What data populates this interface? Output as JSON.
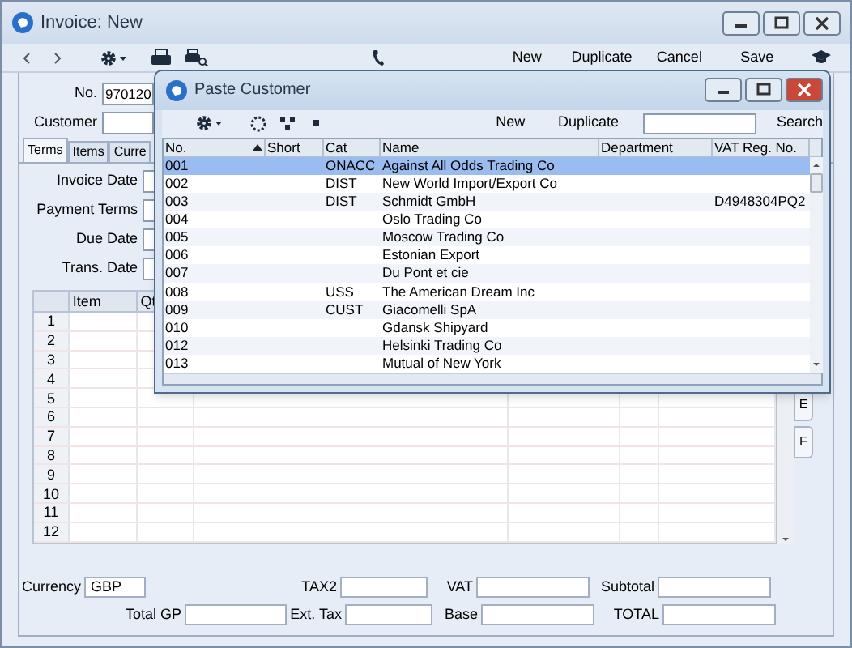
{
  "window": {
    "title": "Invoice: New"
  },
  "toolbar": {
    "buttons": [
      "New",
      "Duplicate",
      "Cancel",
      "Save"
    ]
  },
  "header_fields": [
    {
      "label": "No.",
      "value": "970120"
    },
    {
      "label": "Customer"
    }
  ],
  "tabs": [
    {
      "label": "Terms",
      "selected": true
    },
    {
      "label": "Items",
      "selected": false
    },
    {
      "label": "Curre",
      "selected": false
    }
  ],
  "terms_fields": [
    "Invoice Date",
    "Payment Terms",
    "Due Date",
    "Trans. Date"
  ],
  "grid": {
    "columns": [
      "Item",
      "Qt"
    ],
    "rows": [
      "1",
      "2",
      "3",
      "4",
      "5",
      "6",
      "7",
      "8",
      "9",
      "10",
      "11",
      "12"
    ]
  },
  "side_tabs": [
    "E",
    "F"
  ],
  "footer": {
    "row_1": [
      {
        "label": "Currency",
        "value": "GBP"
      },
      {
        "label": "TAX2"
      },
      {
        "label": "VAT"
      },
      {
        "label": "Subtotal"
      }
    ],
    "row_2": [
      {
        "label": "Total GP"
      },
      {
        "label": "Ext. Tax"
      },
      {
        "label": "Base"
      },
      {
        "label": "TOTAL"
      }
    ]
  },
  "dialog": {
    "title": "Paste Customer",
    "buttons": [
      "New",
      "Duplicate"
    ],
    "search_button": "Search",
    "columns": [
      "No.",
      "Short",
      "Cat",
      "Name",
      "Department",
      "VAT Reg. No."
    ],
    "rows": [
      {
        "cells": [
          "001",
          "",
          "ONACC",
          "Against All Odds Trading Co",
          "",
          ""
        ],
        "selected": true
      },
      {
        "cells": [
          "002",
          "",
          "DIST",
          "New World Import/Export Co",
          "",
          ""
        ],
        "selected": false
      },
      {
        "cells": [
          "003",
          "",
          "DIST",
          "Schmidt GmbH",
          "",
          "D4948304PQ2"
        ],
        "selected": false
      },
      {
        "cells": [
          "004",
          "",
          "",
          "Oslo Trading Co",
          "",
          ""
        ],
        "selected": false
      },
      {
        "cells": [
          "005",
          "",
          "",
          "Moscow Trading Co",
          "",
          ""
        ],
        "selected": false
      },
      {
        "cells": [
          "006",
          "",
          "",
          "Estonian Export",
          "",
          ""
        ],
        "selected": false
      },
      {
        "cells": [
          "007",
          "",
          "",
          "Du Pont et cie",
          "",
          ""
        ],
        "selected": false
      },
      {
        "cells": [
          "008",
          "",
          "USS",
          "The American Dream Inc",
          "",
          ""
        ],
        "selected": false
      },
      {
        "cells": [
          "009",
          "",
          "CUST",
          "Giacomelli SpA",
          "",
          ""
        ],
        "selected": false
      },
      {
        "cells": [
          "010",
          "",
          "",
          "Gdansk Shipyard",
          "",
          ""
        ],
        "selected": false
      },
      {
        "cells": [
          "012",
          "",
          "",
          "Helsinki Trading Co",
          "",
          ""
        ],
        "selected": false
      },
      {
        "cells": [
          "013",
          "",
          "",
          "Mutual of New York",
          "",
          ""
        ],
        "selected": false
      }
    ]
  }
}
